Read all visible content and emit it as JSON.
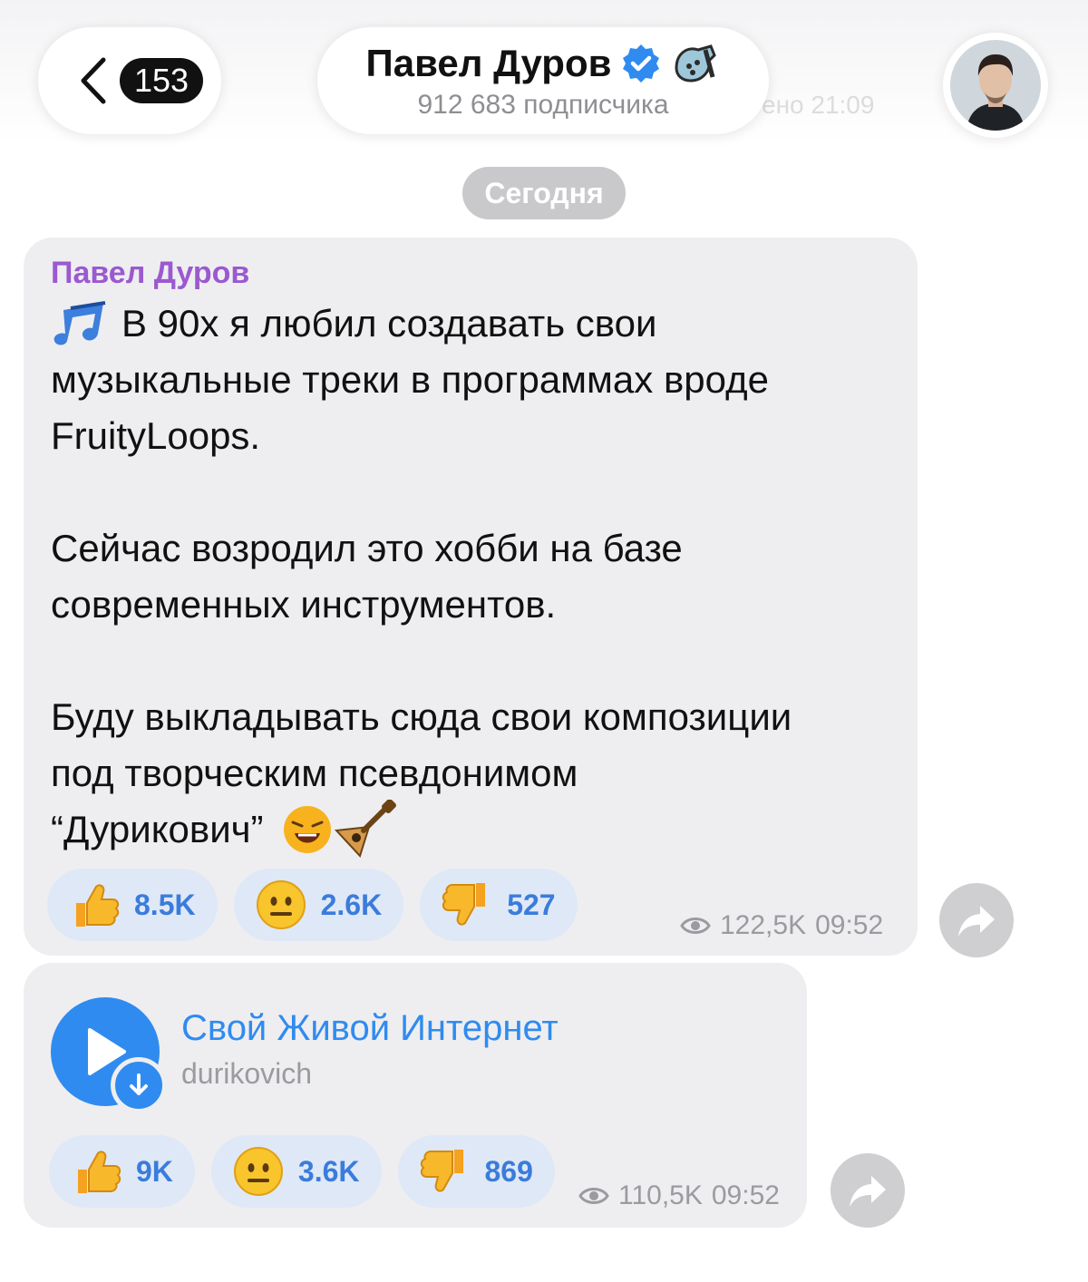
{
  "header": {
    "back_count": "153",
    "channel_name": "Павел Дуров",
    "subscribers": "912 683 подписчика",
    "ghost_text": "ено 21:09"
  },
  "date_chip": "Сегодня",
  "post1": {
    "author": "Павел Дуров",
    "lines": [
      "В 90х я любил создавать свои",
      "музыкальные треки в программах вроде",
      "FruityLoops.",
      "",
      "Сейчас возродил это хобби на базе",
      "современных инструментов.",
      "",
      "Буду выкладывать сюда свои композиции",
      "под творческим псевдонимом",
      "“Дурикович”"
    ],
    "reactions": [
      {
        "icon": "thumbs-up-icon",
        "count": "8.5K"
      },
      {
        "icon": "neutral-face-icon",
        "count": "2.6K"
      },
      {
        "icon": "thumbs-down-icon",
        "count": "527"
      }
    ],
    "views": "122,5K",
    "time": "09:52"
  },
  "post2": {
    "track_title": "Свой Живой Интернет",
    "track_artist": "durikovich",
    "reactions": [
      {
        "icon": "thumbs-up-icon",
        "count": "9K"
      },
      {
        "icon": "neutral-face-icon",
        "count": "3.6K"
      },
      {
        "icon": "thumbs-down-icon",
        "count": "869"
      }
    ],
    "views": "110,5K",
    "time": "09:52"
  },
  "colors": {
    "accent": "#2f8bf0",
    "author": "#9b59d0",
    "bubble": "#eeeef0",
    "reaction_bg": "#dfe8f6",
    "reaction_text": "#3a7cdc"
  }
}
